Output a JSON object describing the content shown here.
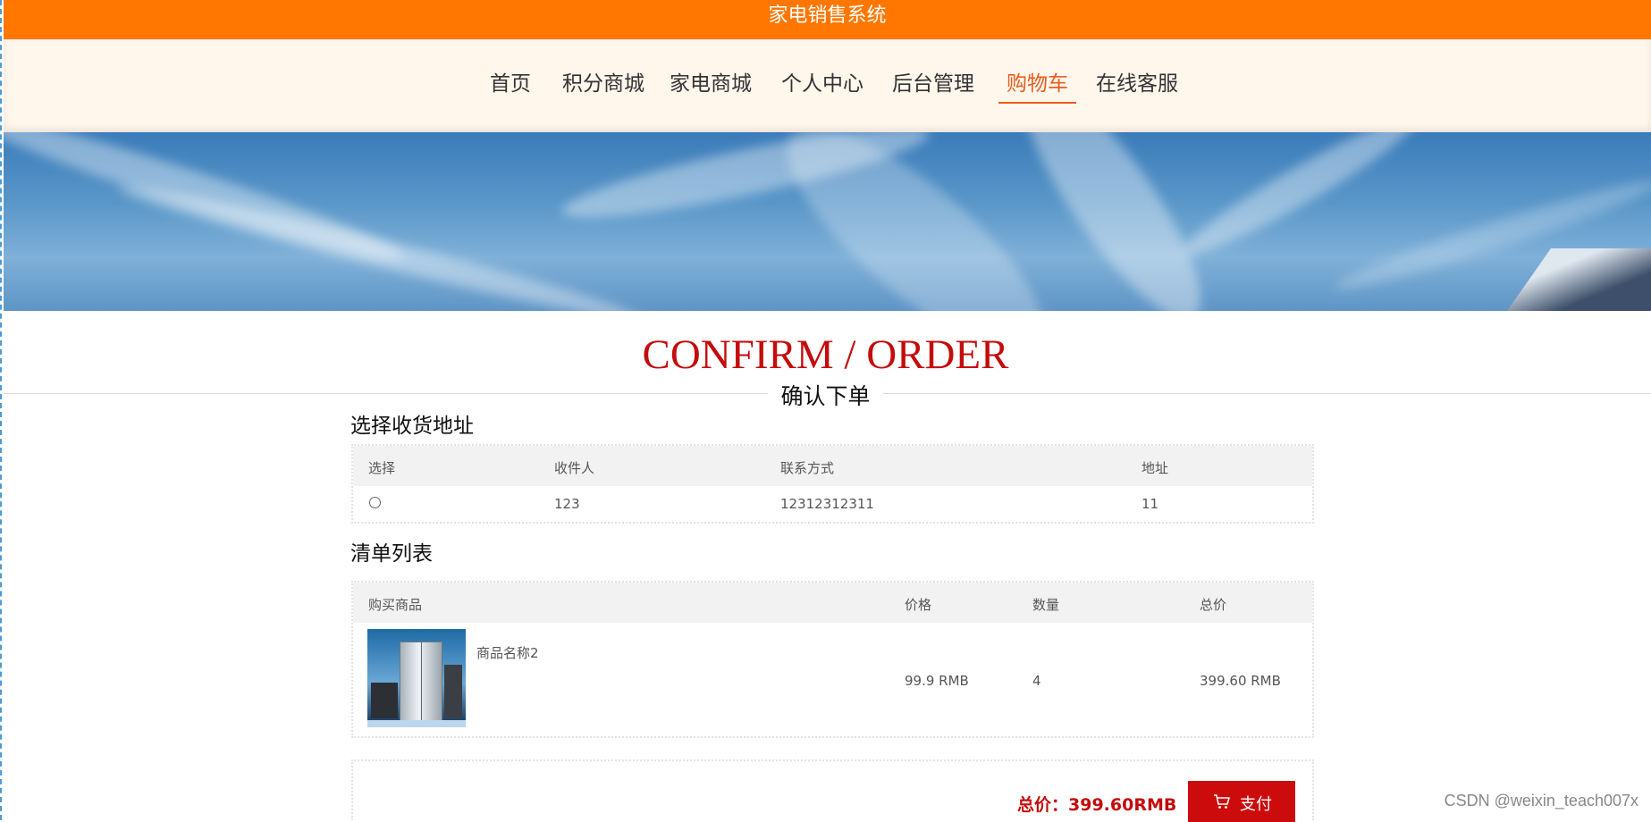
{
  "app": {
    "title": "家电销售系统"
  },
  "nav": {
    "items": [
      {
        "label": "首页"
      },
      {
        "label": "积分商城"
      },
      {
        "label": "家电商城"
      },
      {
        "label": "个人中心"
      },
      {
        "label": "后台管理"
      },
      {
        "label": "购物车",
        "active": true
      },
      {
        "label": "在线客服"
      }
    ]
  },
  "heading": {
    "en": "CONFIRM / ORDER",
    "cn": "确认下单"
  },
  "address": {
    "section_title": "选择收货地址",
    "columns": [
      "选择",
      "收件人",
      "联系方式",
      "地址"
    ],
    "rows": [
      {
        "selected": false,
        "recipient": "123",
        "phone": "12312312311",
        "address": "11"
      }
    ]
  },
  "order": {
    "section_title": "清单列表",
    "columns": [
      "购买商品",
      "价格",
      "数量",
      "总价"
    ],
    "items": [
      {
        "name": "商品名称2",
        "price": "99.9 RMB",
        "quantity": "4",
        "subtotal": "399.60 RMB",
        "image_icon": "refrigerator-product-image"
      }
    ]
  },
  "summary": {
    "total_label": "总价：399.60RMB",
    "pay_label": "支付",
    "pay_icon": "cart-icon"
  },
  "watermark": "CSDN @weixin_teach007x",
  "colors": {
    "topbar": "#ff7700",
    "nav_bg": "#fff6ec",
    "nav_active": "#e85d1e",
    "accent_red": "#c40c0c",
    "pay_button": "#cc0c0c"
  }
}
